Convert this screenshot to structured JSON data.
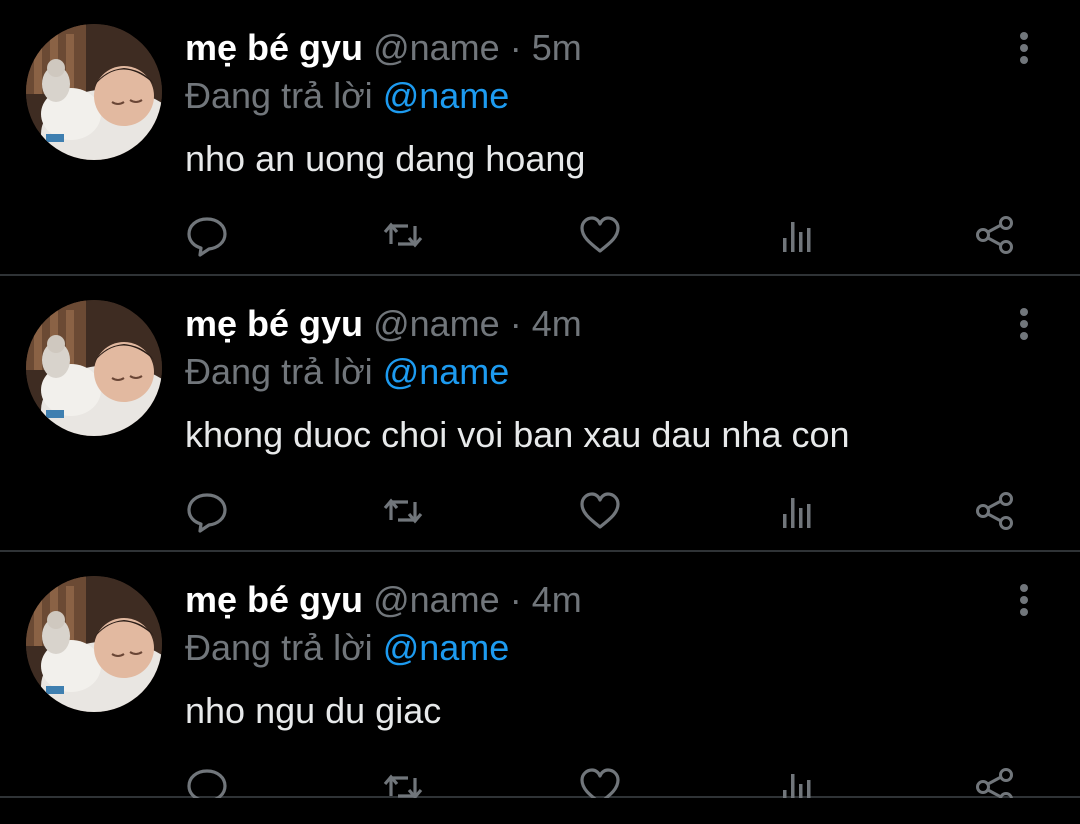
{
  "tweets": [
    {
      "display_name": "mẹ bé gyu",
      "handle": "@name",
      "dot": "·",
      "time": "5m",
      "reply_prefix": "Đang trả lời",
      "reply_to": "@name",
      "text": "nho an uong dang hoang"
    },
    {
      "display_name": "mẹ bé gyu",
      "handle": "@name",
      "dot": "·",
      "time": "4m",
      "reply_prefix": "Đang trả lời",
      "reply_to": "@name",
      "text": "khong duoc choi voi ban xau dau nha con"
    },
    {
      "display_name": "mẹ bé gyu",
      "handle": "@name",
      "dot": "·",
      "time": "4m",
      "reply_prefix": "Đang trả lời",
      "reply_to": "@name",
      "text": "nho ngu du giac"
    }
  ],
  "icons": {
    "reply": "comment-icon",
    "retweet": "retweet-icon",
    "like": "heart-icon",
    "views": "views-icon",
    "share": "share-icon",
    "more": "more-vertical-icon"
  },
  "colors": {
    "background": "#000000",
    "divider": "#2f3336",
    "muted": "#71767b",
    "link": "#1d9bf0",
    "text": "#e7e9ea"
  }
}
